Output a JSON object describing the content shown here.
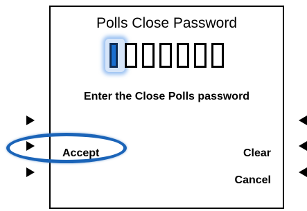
{
  "screen": {
    "title": "Polls Close Password",
    "prompt": "Enter the Close Polls password",
    "digit_count": 7,
    "active_digit_index": 0
  },
  "softkeys": {
    "left": [
      "",
      "Accept",
      ""
    ],
    "right": [
      "",
      "Clear",
      "Cancel"
    ]
  },
  "highlight": {
    "target": "Accept",
    "color": "#1b64b8"
  }
}
